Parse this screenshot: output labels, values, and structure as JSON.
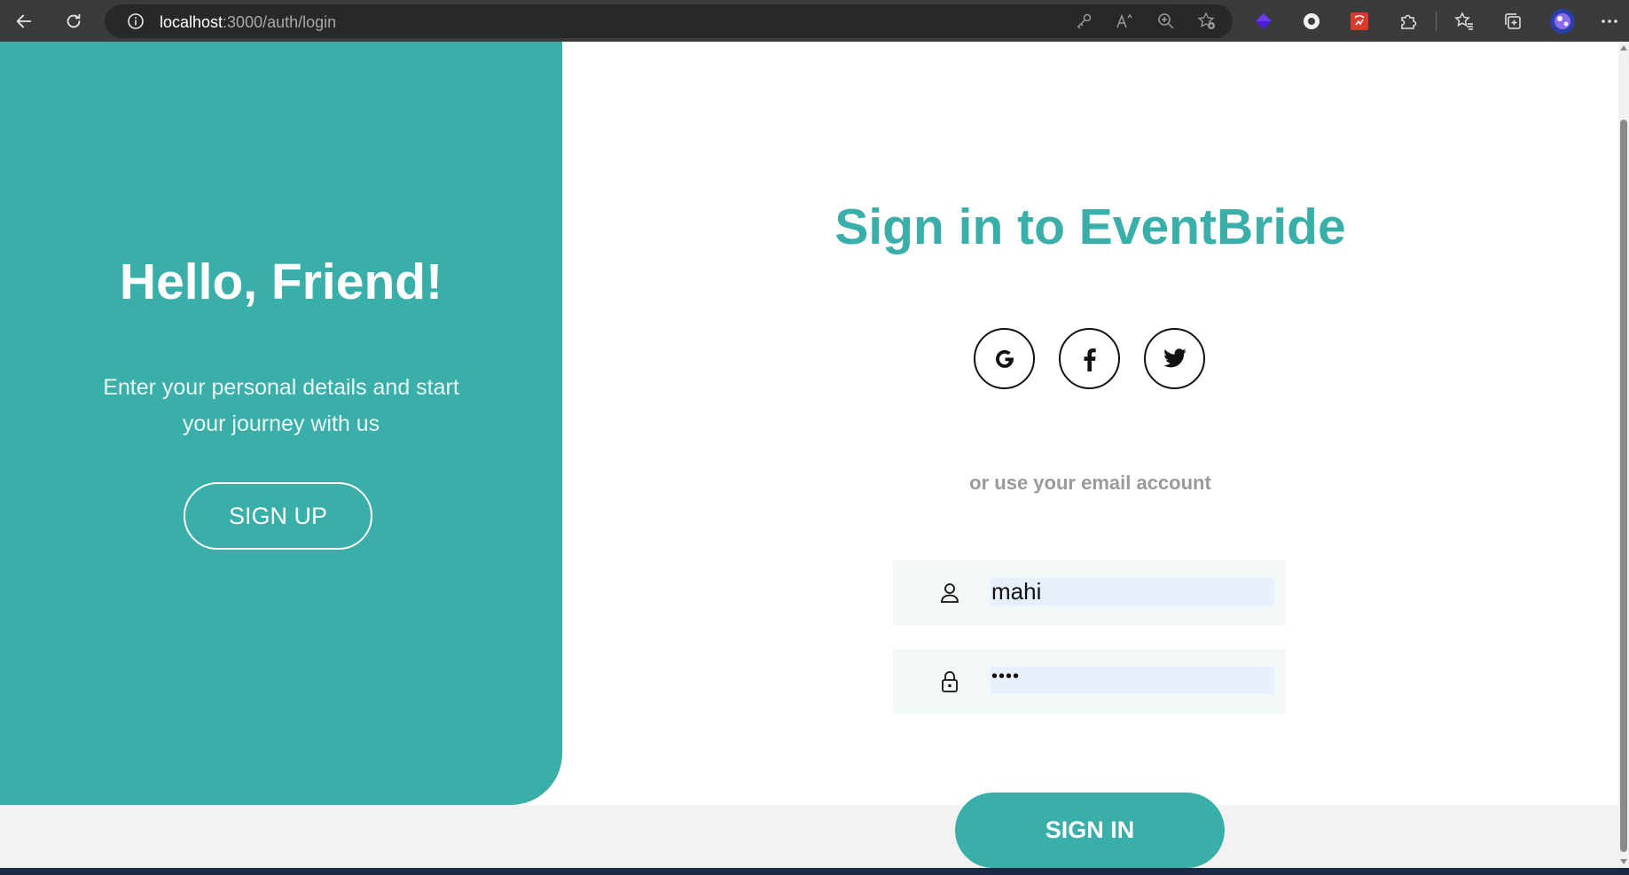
{
  "browser": {
    "url_host": "localhost",
    "url_path": ":3000/auth/login",
    "icons": {
      "back": "back-arrow-icon",
      "refresh": "refresh-icon",
      "site_info": "info-icon",
      "key": "key-icon",
      "read_aloud": "read-aloud-icon",
      "zoom": "zoom-icon",
      "favorite": "add-favorite-icon",
      "extensions": "puzzle-icon",
      "favorites": "favorites-icon",
      "collections": "collections-icon",
      "profile": "profile-avatar-icon",
      "menu": "more-icon"
    }
  },
  "left_panel": {
    "title": "Hello, Friend!",
    "subtitle": "Enter your personal details and start your journey with us",
    "signup_label": "SIGN UP"
  },
  "right_panel": {
    "title": "Sign in to EventBride",
    "social": [
      "google-icon",
      "facebook-icon",
      "twitter-icon"
    ],
    "alt_text": "or use your email account",
    "username_value": "mahi",
    "password_value": "••••",
    "signin_label": "SIGN IN"
  },
  "colors": {
    "accent": "#3aaea8",
    "chrome": "#3b3b3b"
  }
}
